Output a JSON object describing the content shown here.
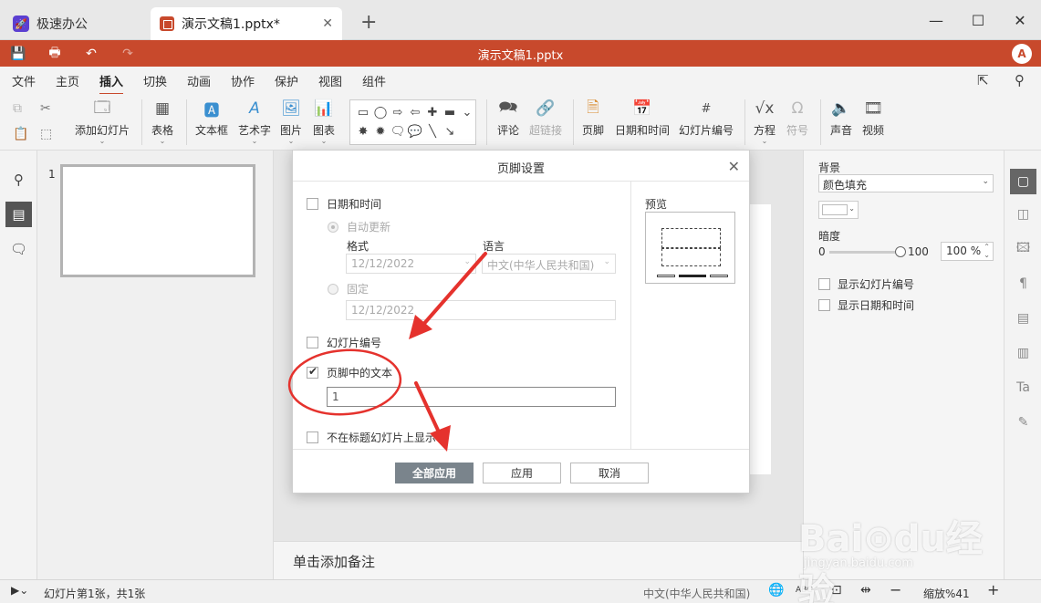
{
  "window": {
    "app_tab_label": "极速办公",
    "doc_tab_label": "演示文稿1.pptx*",
    "new_tab": "+",
    "minimize": "—",
    "maximize": "☐",
    "close": "✕"
  },
  "titlebar": {
    "title": "演示文稿1.pptx",
    "avatar": "A",
    "accent_color": "#c8492c"
  },
  "menu": {
    "items": [
      "文件",
      "主页",
      "插入",
      "切换",
      "动画",
      "协作",
      "保护",
      "视图",
      "组件"
    ],
    "active": "插入"
  },
  "ribbon": {
    "add_slide": "添加幻灯片",
    "table": "表格",
    "textbox": "文本框",
    "wordart": "艺术字",
    "image": "图片",
    "chart": "图表",
    "comment": "评论",
    "hyperlink": "超链接",
    "footer": "页脚",
    "datetime": "日期和时间",
    "slide_number": "幻灯片编号",
    "equation": "方程",
    "symbol": "符号",
    "audio": "声音",
    "video": "视频"
  },
  "thumbs": {
    "slide_number": "1"
  },
  "notes": {
    "placeholder": "单击添加备注"
  },
  "rightpane": {
    "background_label": "背景",
    "fill_option": "颜色填充",
    "opacity_label": "暗度",
    "opacity_min": "0",
    "opacity_max": "100",
    "opacity_value": "100 %",
    "show_slide_number": "显示幻灯片编号",
    "show_datetime": "显示日期和时间"
  },
  "dialog": {
    "title": "页脚设置",
    "datetime_label": "日期和时间",
    "auto_update": "自动更新",
    "format_label": "格式",
    "language_label": "语言",
    "format_value": "12/12/2022",
    "language_value": "中文(中华人民共和国)",
    "fixed_label": "固定",
    "fixed_value": "12/12/2022",
    "slide_number_label": "幻灯片编号",
    "footer_text_label": "页脚中的文本",
    "footer_text_value": "1",
    "hide_on_title_label": "不在标题幻灯片上显示",
    "preview_label": "预览",
    "apply_all": "全部应用",
    "apply": "应用",
    "cancel": "取消",
    "footer_text_checked": true
  },
  "status": {
    "slide_info": "幻灯片第1张，共1张",
    "language": "中文(中华人民共和国)",
    "spell": "ABC",
    "zoom_label": "缩放%41",
    "zoom_out": "−",
    "zoom_in": "+"
  },
  "watermark": {
    "brand": "Bai⊙du经验",
    "url": "jingyan.baidu.com"
  }
}
